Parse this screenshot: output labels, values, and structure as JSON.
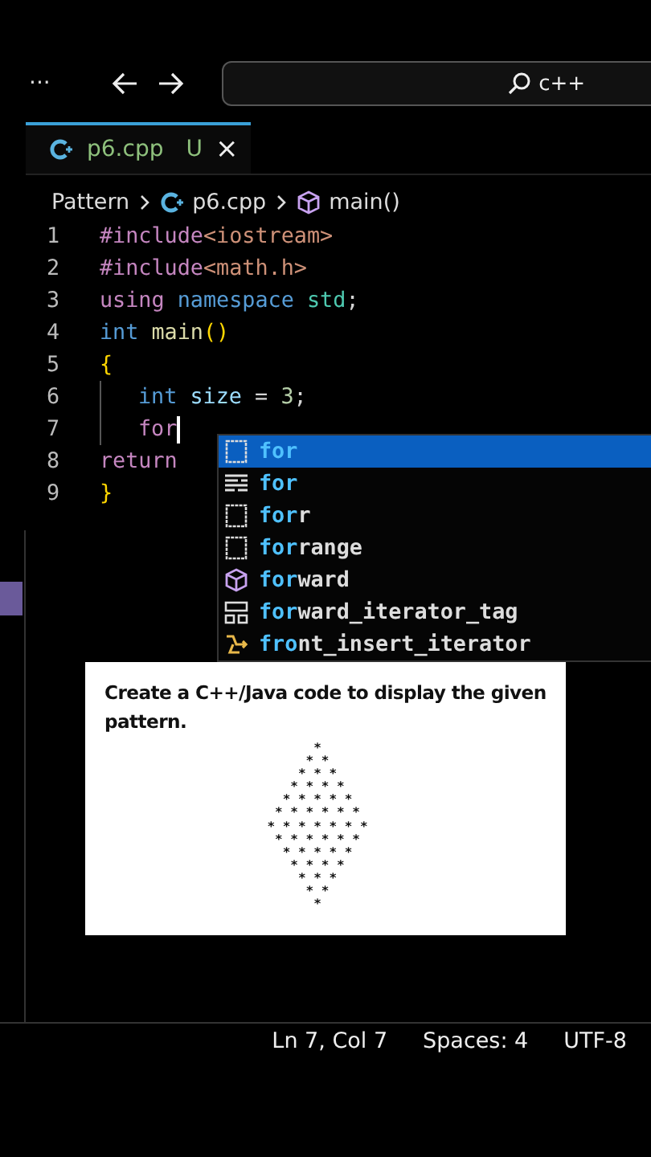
{
  "toolbar": {
    "more": "···",
    "search": "c++"
  },
  "tabs": [
    {
      "label": "p6.cpp",
      "status": "U",
      "close": "×",
      "selected": true
    }
  ],
  "breadcrumb": [
    {
      "label": "Pattern"
    },
    {
      "label": "p6.cpp"
    },
    {
      "label": "main()"
    }
  ],
  "lines": [
    {
      "number": "1",
      "caret": false,
      "tokens": [
        {
          "text": "#include",
          "kind": "directive"
        },
        {
          "text": "<iostream>",
          "kind": "string"
        }
      ]
    },
    {
      "number": "2",
      "caret": false,
      "tokens": [
        {
          "text": "#include",
          "kind": "directive"
        },
        {
          "text": "<math.h>",
          "kind": "string"
        }
      ]
    },
    {
      "number": "3",
      "caret": false,
      "tokens": [
        {
          "text": "using ",
          "kind": "directive"
        },
        {
          "text": "namespace ",
          "kind": "keyword"
        },
        {
          "text": "std",
          "kind": "namespace"
        },
        {
          "text": ";",
          "kind": "plain"
        }
      ]
    },
    {
      "number": "4",
      "caret": false,
      "tokens": [
        {
          "text": "int ",
          "kind": "keyword"
        },
        {
          "text": "main",
          "kind": "function"
        },
        {
          "text": "()",
          "kind": "bracket"
        }
      ]
    },
    {
      "number": "5",
      "caret": false,
      "tokens": [
        {
          "text": "{",
          "kind": "bracket"
        }
      ],
      "children": [
        {
          "number": "6",
          "caret": false,
          "tokens": [
            {
              "text": "int ",
              "kind": "keyword"
            },
            {
              "text": "size",
              "kind": "variable"
            },
            {
              "text": " = ",
              "kind": "plain"
            },
            {
              "text": "3",
              "kind": "number"
            },
            {
              "text": ";",
              "kind": "plain"
            }
          ]
        },
        {
          "number": "7",
          "caret": true,
          "tokens": [
            {
              "text": "for",
              "kind": "directive"
            }
          ]
        }
      ]
    },
    {
      "number": "8",
      "caret": false,
      "tokens": [
        {
          "text": "return",
          "kind": "directive"
        }
      ]
    },
    {
      "number": "9",
      "caret": false,
      "tokens": [
        {
          "text": "}",
          "kind": "bracket"
        }
      ]
    }
  ],
  "suggestions": [
    {
      "match": "for",
      "kind": "snippet",
      "selected": true
    },
    {
      "match": "for",
      "kind": "keyword",
      "selected": false
    },
    {
      "match": "for",
      "rest": "r",
      "kind": "snippet",
      "selected": false
    },
    {
      "match": "for",
      "rest": "range",
      "kind": "snippet",
      "selected": false
    },
    {
      "match": "for",
      "rest": "ward",
      "kind": "class",
      "selected": false
    },
    {
      "match": "for",
      "rest": "ward_iterator_tag",
      "kind": "struct",
      "selected": false
    },
    {
      "match": "fro",
      "rest": "nt_insert_iterator",
      "kind": "function",
      "selected": false
    }
  ],
  "question_card": {
    "text": "Create a C++/Java code to display the given pattern.",
    "pattern": "*\n* *\n* * *\n* * * *\n* * * * *\n* * * * * *\n* * * * * * *\n* * * * * *\n* * * * *\n* * * *\n* * *\n* *\n*"
  },
  "status_bar": [
    "Ln 7, Col 7",
    "Spaces: 4",
    "UTF-8"
  ]
}
